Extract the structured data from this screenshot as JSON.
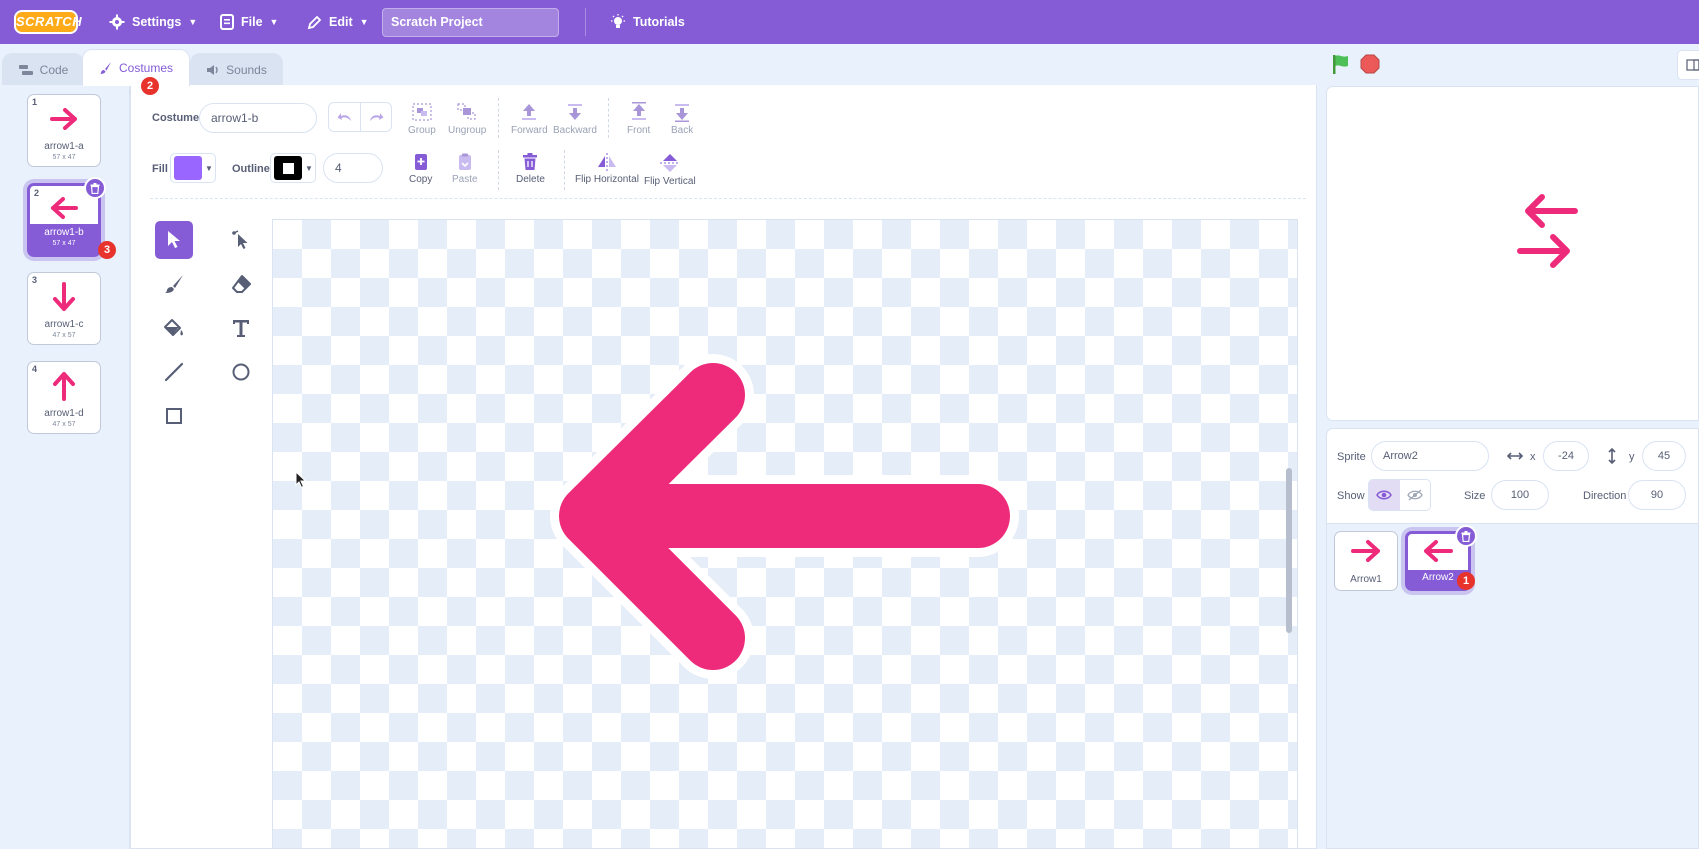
{
  "menu": {
    "logo_text": "SCRATCH",
    "settings_label": "Settings",
    "file_label": "File",
    "edit_label": "Edit",
    "project_title": "Scratch Project",
    "tutorials_label": "Tutorials"
  },
  "tabs": {
    "code": "Code",
    "costumes": "Costumes",
    "sounds": "Sounds"
  },
  "costumes": [
    {
      "index": "1",
      "name": "arrow1-a",
      "size": "57 x 47",
      "direction": "right"
    },
    {
      "index": "2",
      "name": "arrow1-b",
      "size": "57 x 47",
      "direction": "left",
      "selected": true
    },
    {
      "index": "3",
      "name": "arrow1-c",
      "size": "47 x 57",
      "direction": "down"
    },
    {
      "index": "4",
      "name": "arrow1-d",
      "size": "47 x 57",
      "direction": "up"
    }
  ],
  "markers": [
    "1",
    "2",
    "3"
  ],
  "paint": {
    "costume_label": "Costume",
    "costume_name": "arrow1-b",
    "group": "Group",
    "ungroup": "Ungroup",
    "forward": "Forward",
    "backward": "Backward",
    "front": "Front",
    "back": "Back",
    "fill_label": "Fill",
    "fill_color": "#9966ff",
    "outline_label": "Outline",
    "outline_color": "#000000",
    "outline_width": "4",
    "copy": "Copy",
    "paste": "Paste",
    "delete": "Delete",
    "flip_horizontal": "Flip Horizontal",
    "flip_vertical": "Flip Vertical",
    "tools": [
      "select-tool",
      "reshape-tool",
      "brush-tool",
      "eraser-tool",
      "fill-tool",
      "text-tool",
      "line-tool",
      "circle-tool",
      "rectangle-tool"
    ],
    "active_tool": "select-tool"
  },
  "sprite_info": {
    "sprite_label": "Sprite",
    "sprite_name": "Arrow2",
    "x_label": "x",
    "x_value": "-24",
    "y_label": "y",
    "y_value": "45",
    "show_label": "Show",
    "size_label": "Size",
    "size_value": "100",
    "direction_label": "Direction",
    "direction_value": "90"
  },
  "sprites": [
    {
      "name": "Arrow1",
      "direction": "right"
    },
    {
      "name": "Arrow2",
      "direction": "left",
      "selected": true
    }
  ],
  "colors": {
    "accent": "#855cd6",
    "arrow": "#ee2b7a",
    "marker": "#e8322c",
    "green_flag": "#4cbf56",
    "stop": "#ec5959"
  }
}
